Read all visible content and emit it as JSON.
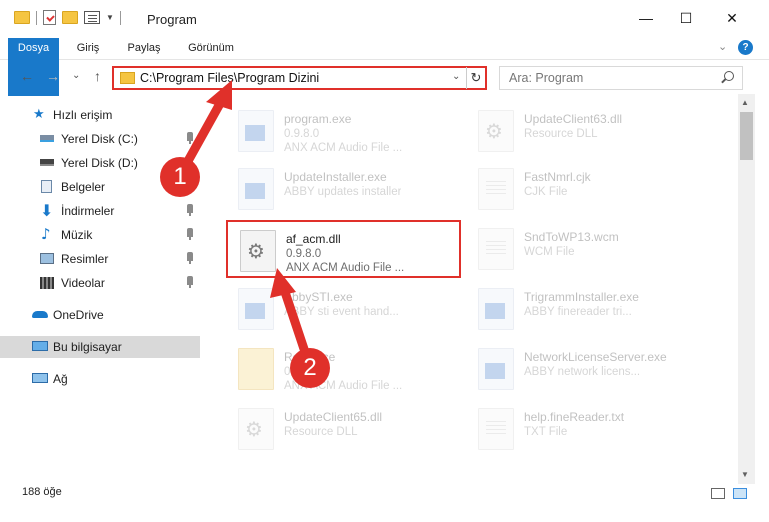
{
  "window": {
    "title": "Program",
    "minimize": "—",
    "maximize": "☐",
    "close": "✕"
  },
  "ribbon": {
    "tabs": [
      "Dosya",
      "Giriş",
      "Paylaş",
      "Görünüm"
    ],
    "expand": "⌄",
    "help": "?"
  },
  "nav": {
    "back": "←",
    "forward": "→",
    "recent": "⌄",
    "up": "↑",
    "address": "C:\\Program Files\\Program Dizini",
    "address_dropdown": "⌄",
    "refresh": "↻",
    "search_placeholder": "Ara: Program"
  },
  "sidebar": {
    "items": [
      {
        "label": "Hızlı erişim",
        "icon": "star-icon",
        "color": "#1979ca"
      },
      {
        "label": "Yerel Disk (C:)",
        "icon": "drive-icon",
        "pinned": true
      },
      {
        "label": "Yerel Disk (D:)",
        "icon": "drive-icon",
        "pinned": true
      },
      {
        "label": "Belgeler",
        "icon": "documents-icon",
        "pinned": true
      },
      {
        "label": "İndirmeler",
        "icon": "downloads-icon",
        "pinned": true
      },
      {
        "label": "Müzik",
        "icon": "music-icon",
        "pinned": true
      },
      {
        "label": "Resimler",
        "icon": "pictures-icon",
        "pinned": true
      },
      {
        "label": "Videolar",
        "icon": "videos-icon",
        "pinned": true
      },
      {
        "label": "OneDrive",
        "icon": "cloud-icon"
      },
      {
        "label": "Bu bilgisayar",
        "icon": "computer-icon",
        "selected": true
      },
      {
        "label": "Ağ",
        "icon": "network-icon"
      }
    ]
  },
  "files": [
    {
      "name": "program.exe",
      "line2": "0.9.8.0",
      "line3": "ANX ACM Audio File ...",
      "type": "exe",
      "faded": true
    },
    {
      "name": "UpdateClient63.dll",
      "line2": "Resource DLL",
      "line3": "",
      "type": "dll",
      "faded": true
    },
    {
      "name": "UpdateInstaller.exe",
      "line2": "ABBY updates installer",
      "line3": "",
      "type": "exe",
      "faded": true
    },
    {
      "name": "FastNmrl.cjk",
      "line2": "CJK File",
      "line3": "",
      "type": "txt",
      "faded": true
    },
    {
      "name": "af_acm.dll",
      "line2": "0.9.8.0",
      "line3": "ANX ACM Audio File ...",
      "type": "dll",
      "faded": false,
      "highlight": true
    },
    {
      "name": "SndToWP13.wcm",
      "line2": "WCM File",
      "line3": "",
      "type": "txt",
      "faded": true
    },
    {
      "name": "AbbySTI.exe",
      "line2": "ABBY sti event hand...",
      "line3": "",
      "type": "exe",
      "faded": true
    },
    {
      "name": "TrigrammInstaller.exe",
      "line2": "ABBY finereader tri...",
      "line3": "",
      "type": "exe",
      "faded": true
    },
    {
      "name": "Resource",
      "line2": "0.9.8.0",
      "line3": "ANX ACM Audio File ...",
      "type": "folder",
      "faded": true
    },
    {
      "name": "NetworkLicenseServer.exe",
      "line2": "ABBY network licens...",
      "line3": "",
      "type": "exe",
      "faded": true
    },
    {
      "name": "UpdateClient65.dll",
      "line2": "Resource DLL",
      "line3": "",
      "type": "dll",
      "faded": true
    },
    {
      "name": "help.fineReader.txt",
      "line2": "TXT File",
      "line3": "",
      "type": "txt",
      "faded": true
    }
  ],
  "status": {
    "count": "188 öğe"
  },
  "annotations": {
    "badge1": "1",
    "badge2": "2",
    "color": "#e0302a"
  }
}
